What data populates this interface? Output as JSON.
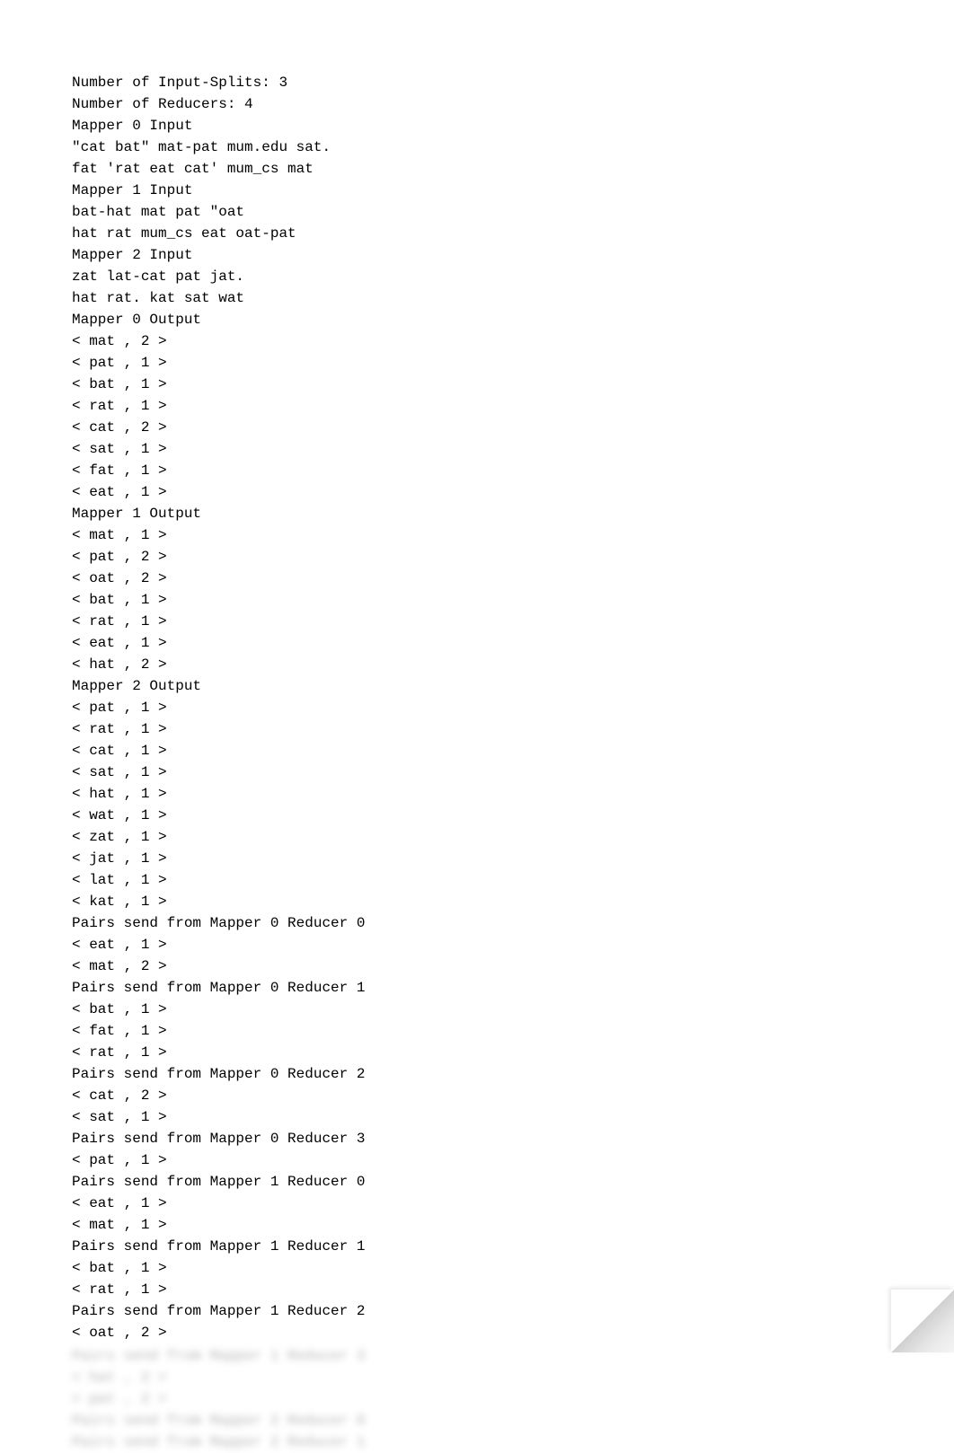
{
  "lines": [
    "Number of Input-Splits: 3",
    "Number of Reducers: 4",
    "Mapper 0 Input",
    "\"cat bat\" mat-pat mum.edu sat.",
    "fat 'rat eat cat' mum_cs mat",
    "Mapper 1 Input",
    "bat-hat mat pat \"oat",
    "hat rat mum_cs eat oat-pat",
    "Mapper 2 Input",
    "zat lat-cat pat jat.",
    "hat rat. kat sat wat",
    "Mapper 0 Output",
    "< mat , 2 >",
    "< pat , 1 >",
    "< bat , 1 >",
    "< rat , 1 >",
    "< cat , 2 >",
    "< sat , 1 >",
    "< fat , 1 >",
    "< eat , 1 >",
    "Mapper 1 Output",
    "< mat , 1 >",
    "< pat , 2 >",
    "< oat , 2 >",
    "< bat , 1 >",
    "< rat , 1 >",
    "< eat , 1 >",
    "< hat , 2 >",
    "Mapper 2 Output",
    "< pat , 1 >",
    "< rat , 1 >",
    "< cat , 1 >",
    "< sat , 1 >",
    "< hat , 1 >",
    "< wat , 1 >",
    "< zat , 1 >",
    "< jat , 1 >",
    "< lat , 1 >",
    "< kat , 1 >",
    "Pairs send from Mapper 0 Reducer 0",
    "< eat , 1 >",
    "< mat , 2 >",
    "Pairs send from Mapper 0 Reducer 1",
    "< bat , 1 >",
    "< fat , 1 >",
    "< rat , 1 >",
    "Pairs send from Mapper 0 Reducer 2",
    "< cat , 2 >",
    "< sat , 1 >",
    "Pairs send from Mapper 0 Reducer 3",
    "< pat , 1 >",
    "Pairs send from Mapper 1 Reducer 0",
    "< eat , 1 >",
    "< mat , 1 >",
    "Pairs send from Mapper 1 Reducer 1",
    "< bat , 1 >",
    "< rat , 1 >",
    "Pairs send from Mapper 1 Reducer 2",
    "< oat , 2 >"
  ],
  "blurred_lines": [
    "Pairs send from Mapper 1 Reducer 3",
    "< hat , 2 >",
    "< pat , 2 >",
    "Pairs send from Mapper 2 Reducer 0",
    "Pairs send from Mapper 2 Reducer 1"
  ]
}
